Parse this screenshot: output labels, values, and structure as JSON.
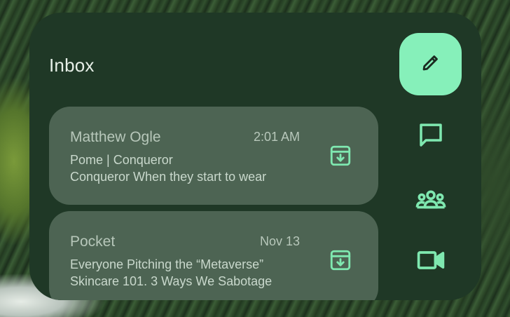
{
  "widget": {
    "title": "Inbox"
  },
  "emails": [
    {
      "sender": "Matthew Ogle",
      "time": "2:01 AM",
      "line1": "Pome | Conqueror",
      "line2": "Conqueror When they start to wear",
      "action_icon": "archive-icon"
    },
    {
      "sender": "Pocket",
      "time": "Nov 13",
      "line1": "Everyone Pitching the “Metaverse”",
      "line2": "Skincare 101. 3 Ways We Sabotage",
      "action_icon": "archive-icon"
    }
  ],
  "actions": {
    "compose_icon": "pencil-icon",
    "chat_icon": "chat-bubble-icon",
    "spaces_icon": "group-icon",
    "meet_icon": "video-camera-icon"
  },
  "colors": {
    "widget_bg": "#1f3826",
    "card_bg": "#4d6453",
    "accent": "#86f0ba",
    "icon_accent": "#7fe8b0",
    "title_text": "#e6efe7"
  }
}
